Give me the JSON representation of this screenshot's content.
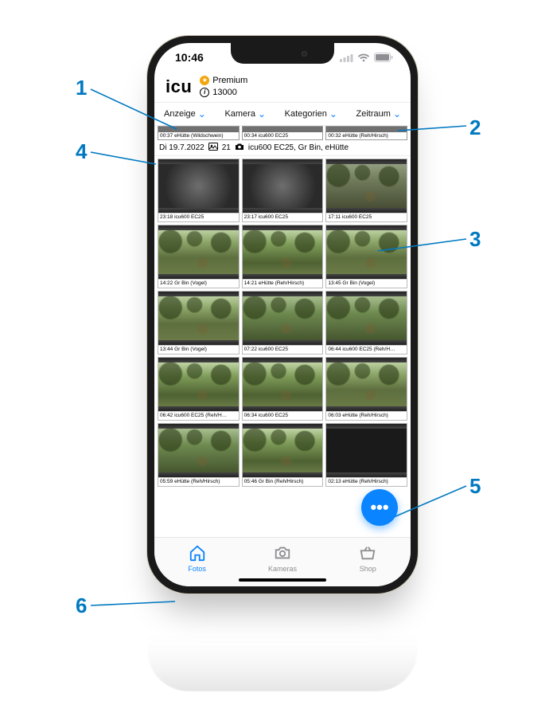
{
  "accent": "#0a84ff",
  "status": {
    "time": "10:46"
  },
  "header": {
    "logo": "icu",
    "plan_label": "Premium",
    "credits": "13000"
  },
  "filters": [
    {
      "label": "Anzeige"
    },
    {
      "label": "Kamera"
    },
    {
      "label": "Kategorien"
    },
    {
      "label": "Zeitraum"
    }
  ],
  "peek": [
    "00:37 eHütte  (Wildschwein)",
    "00:34 icu600 EC25",
    "00:32 eHütte  (Reh/Hirsch)"
  ],
  "day": {
    "date": "Di 19.7.2022",
    "count": "21",
    "cams": "icu600 EC25, Gr Bin, eHütte"
  },
  "rows": [
    [
      {
        "cap": "23:18 icu600 EC25",
        "cls": "night"
      },
      {
        "cap": "23:17 icu600 EC25",
        "cls": "night"
      },
      {
        "cap": "17:11 icu600 EC25",
        "cls": "dusk"
      }
    ],
    [
      {
        "cap": "14:22 Gr Bin  (Vogel)",
        "cls": "day1"
      },
      {
        "cap": "14:21 eHütte  (Reh/Hirsch)",
        "cls": "day2"
      },
      {
        "cap": "13:45 Gr Bin  (Vogel)",
        "cls": "day1"
      }
    ],
    [
      {
        "cap": "13:44 Gr Bin  (Vogel)",
        "cls": "day1"
      },
      {
        "cap": "07:22 icu600 EC25",
        "cls": "day3"
      },
      {
        "cap": "06:44 icu600 EC25  (Reh/H…",
        "cls": "day3"
      }
    ],
    [
      {
        "cap": "06:42 icu600 EC25  (Reh/H…",
        "cls": "day2"
      },
      {
        "cap": "06:34 icu600 EC25",
        "cls": "day2"
      },
      {
        "cap": "06:03 eHütte  (Reh/Hirsch)",
        "cls": "day1"
      }
    ],
    [
      {
        "cap": "05:59 eHütte  (Reh/Hirsch)",
        "cls": "day3"
      },
      {
        "cap": "05:46 Gr Bin  (Reh/Hirsch)",
        "cls": "day2"
      },
      {
        "cap": "02:13 eHütte  (Reh/Hirsch)",
        "cls": "dark"
      }
    ]
  ],
  "tabs": {
    "fotos": "Fotos",
    "kameras": "Kameras",
    "shop": "Shop"
  },
  "callouts": {
    "n1": "1",
    "n2": "2",
    "n3": "3",
    "n4": "4",
    "n5": "5",
    "n6": "6"
  }
}
